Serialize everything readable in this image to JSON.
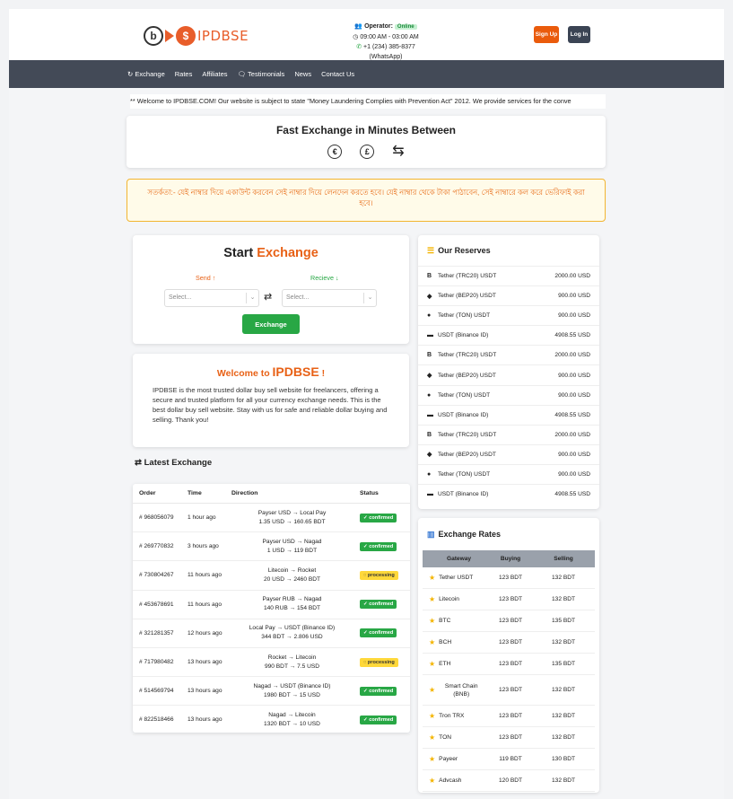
{
  "header": {
    "logo_text": "IPDBSE",
    "operator_label": "Operator:",
    "online_label": "Online",
    "hours": "09:00 AM - 03:00 AM",
    "phone": "+1 (234) 385-8377 (WhatsApp)",
    "signup_label": "Sign Up",
    "login_label": "Log In"
  },
  "nav": {
    "items": [
      {
        "label": "Exchange"
      },
      {
        "label": "Rates"
      },
      {
        "label": "Affiliates"
      },
      {
        "label": "Testimonials"
      },
      {
        "label": "News"
      },
      {
        "label": "Contact Us"
      }
    ]
  },
  "marquee": "** Welcome to IPDBSE.COM! Our website is subject to state \"Money Laundering Complies with Prevention Act\" 2012. We provide services for the conve",
  "fast": {
    "title": "Fast Exchange in Minutes Between",
    "icons": [
      "€",
      "£",
      "⇆"
    ]
  },
  "warning": "সতর্কতা:- যেই নাম্বার দিয়ে একাউন্ট করবেন সেই নাম্বার দিয়ে লেনদেন করতে হবে। যেই নাম্বার থেকে টাকা পাঠাবেন, সেই নাম্বারে কল করে ভেরিফাই করা হবে।",
  "start": {
    "title_a": "Start",
    "title_b": "Exchange",
    "send_label": "Send ↑",
    "receive_label": "Recieve ↓",
    "send_placeholder": "Select...",
    "receive_placeholder": "Select...",
    "button": "Exchange"
  },
  "welcome": {
    "title_a": "Welcome to",
    "title_b": "IPDBSE",
    "title_c": "!",
    "text": "IPDBSE is the most trusted dollar buy sell website for freelancers, offering a secure and trusted platform for all your currency exchange needs. This is the best dollar buy sell website. Stay with us for safe and reliable dollar buying and selling. Thank you!"
  },
  "latest": {
    "title": "Latest Exchange",
    "headers": [
      "Order",
      "Time",
      "Direction",
      "Status"
    ],
    "rows": [
      {
        "order": "# 968056079",
        "time": "1 hour ago",
        "dir1": "Payser USD → Local Pay",
        "dir2": "1.35 USD → 160.65 BDT",
        "status": "confirmed"
      },
      {
        "order": "# 269770832",
        "time": "3 hours ago",
        "dir1": "Payser USD → Nagad",
        "dir2": "1 USD → 119 BDT",
        "status": "confirmed"
      },
      {
        "order": "# 730804267",
        "time": "11 hours ago",
        "dir1": "Litecoin → Rocket",
        "dir2": "20 USD → 2460 BDT",
        "status": "processing"
      },
      {
        "order": "# 453678691",
        "time": "11 hours ago",
        "dir1": "Payser RUB → Nagad",
        "dir2": "140 RUB → 154 BDT",
        "status": "confirmed"
      },
      {
        "order": "# 321281357",
        "time": "12 hours ago",
        "dir1": "Local Pay → USDT (Binance ID)",
        "dir2": "344 BDT → 2.806 USD",
        "status": "confirmed"
      },
      {
        "order": "# 717980482",
        "time": "13 hours ago",
        "dir1": "Rocket → Litecoin",
        "dir2": "990 BDT → 7.5 USD",
        "status": "processing"
      },
      {
        "order": "# 514569794",
        "time": "13 hours ago",
        "dir1": "Nagad → USDT (Binance ID)",
        "dir2": "1980 BDT → 15 USD",
        "status": "confirmed"
      },
      {
        "order": "# 822518466",
        "time": "13 hours ago",
        "dir1": "Nagad → Litecoin",
        "dir2": "1320 BDT → 10 USD",
        "status": "confirmed"
      }
    ]
  },
  "reserves": {
    "title": "Our Reserves",
    "rows": [
      {
        "icon": "B",
        "name": "Tether (TRC20) USDT",
        "amount": "2000.00 USD"
      },
      {
        "icon": "◆",
        "name": "Tether (BEP20) USDT",
        "amount": "900.00 USD"
      },
      {
        "icon": "●",
        "name": "Tether (TON) USDT",
        "amount": "900.00 USD"
      },
      {
        "icon": "▬",
        "name": "USDT (Binance ID)",
        "amount": "4908.55 USD"
      },
      {
        "icon": "B",
        "name": "Tether (TRC20) USDT",
        "amount": "2000.00 USD"
      },
      {
        "icon": "◆",
        "name": "Tether (BEP20) USDT",
        "amount": "900.00 USD"
      },
      {
        "icon": "●",
        "name": "Tether (TON) USDT",
        "amount": "900.00 USD"
      },
      {
        "icon": "▬",
        "name": "USDT (Binance ID)",
        "amount": "4908.55 USD"
      },
      {
        "icon": "B",
        "name": "Tether (TRC20) USDT",
        "amount": "2000.00 USD"
      },
      {
        "icon": "◆",
        "name": "Tether (BEP20) USDT",
        "amount": "900.00 USD"
      },
      {
        "icon": "●",
        "name": "Tether (TON) USDT",
        "amount": "900.00 USD"
      },
      {
        "icon": "▬",
        "name": "USDT (Binance ID)",
        "amount": "4908.55 USD"
      }
    ]
  },
  "rates": {
    "title": "Exchange Rates",
    "headers": [
      "Gateway",
      "Buying",
      "Selling"
    ],
    "rows": [
      {
        "gateway": "Tether USDT",
        "buy": "123 BDT",
        "sell": "132 BDT"
      },
      {
        "gateway": "Litecoin",
        "buy": "123 BDT",
        "sell": "132 BDT"
      },
      {
        "gateway": "BTC",
        "buy": "123 BDT",
        "sell": "135 BDT"
      },
      {
        "gateway": "BCH",
        "buy": "123 BDT",
        "sell": "132 BDT"
      },
      {
        "gateway": "ETH",
        "buy": "123 BDT",
        "sell": "135 BDT"
      },
      {
        "gateway": "Smart Chain (BNB)",
        "buy": "123 BDT",
        "sell": "132 BDT"
      },
      {
        "gateway": "Tron TRX",
        "buy": "123 BDT",
        "sell": "132 BDT"
      },
      {
        "gateway": "TON",
        "buy": "123 BDT",
        "sell": "132 BDT"
      },
      {
        "gateway": "Payeer",
        "buy": "119 BDT",
        "sell": "130 BDT"
      },
      {
        "gateway": "Advcash",
        "buy": "120 BDT",
        "sell": "132 BDT"
      }
    ]
  }
}
